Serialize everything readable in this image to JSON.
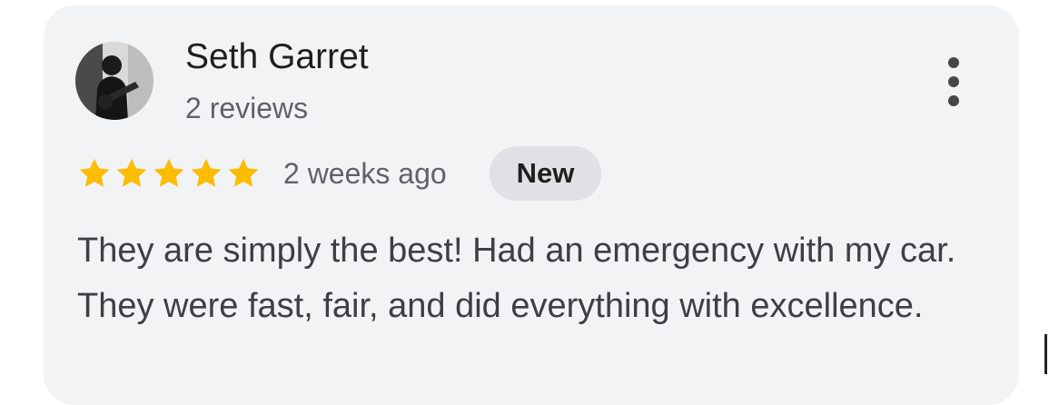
{
  "reviewer": {
    "name": "Seth Garret",
    "review_count": "2 reviews",
    "avatar_icon": "user-avatar-photo"
  },
  "rating": {
    "stars": 5,
    "max_stars": 5,
    "star_color": "#fbbc04"
  },
  "meta": {
    "time_ago": "2 weeks ago",
    "badge": "New"
  },
  "menu": {
    "icon": "more-vertical-icon"
  },
  "review": {
    "text": "They are simply the best! Had an emergency with my car. They were fast, fair, and did everything with excellence."
  },
  "colors": {
    "card_background": "#f2f3f5",
    "badge_background": "#dfe1e4",
    "primary_text": "#1f1f1f",
    "secondary_text": "#5f6368"
  }
}
